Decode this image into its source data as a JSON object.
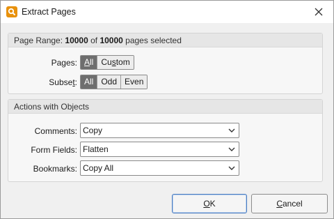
{
  "window": {
    "title": "Extract Pages"
  },
  "icons": {
    "app": "pdf-app-icon",
    "close": "close-icon",
    "chevron": "chevron-down-icon"
  },
  "page_range": {
    "prefix": "Page Range: ",
    "selected": "10000",
    "of": " of ",
    "total": "10000",
    "suffix": " pages selected"
  },
  "pages": {
    "label_pre": "Pages",
    "label_post": ":",
    "options": [
      {
        "pre": "",
        "ul": "A",
        "post": "ll"
      },
      {
        "pre": "Cu",
        "ul": "s",
        "post": "tom"
      }
    ],
    "selected": "All"
  },
  "subset": {
    "label_pre": "Subse",
    "label_ul": "t",
    "label_post": ":",
    "options": [
      "All",
      "Odd",
      "Even"
    ],
    "selected": "All"
  },
  "actions": {
    "header": "Actions with Objects",
    "comments_label": "Comments:",
    "comments_value": "Copy",
    "form_fields_label": "Form Fields:",
    "form_fields_value": "Flatten",
    "bookmarks_label": "Bookmarks:",
    "bookmarks_value": "Copy All"
  },
  "buttons": {
    "ok_ul": "O",
    "ok_post": "K",
    "cancel_ul": "C",
    "cancel_post": "ancel"
  },
  "colors": {
    "accent_orange": "#e8910c",
    "segment_active": "#6e6e6e",
    "primary_border": "#4a7cc0"
  }
}
